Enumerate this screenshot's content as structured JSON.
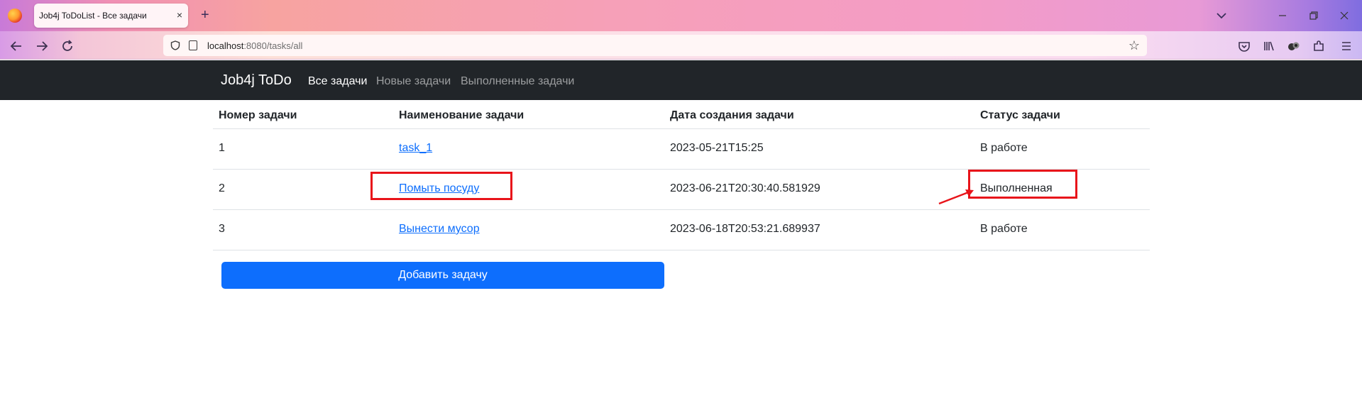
{
  "browser": {
    "tab_title": "Job4j ToDoList - Все задачи",
    "tab_close": "×",
    "new_tab": "+",
    "url_host": "localhost",
    "url_rest": ":8080/tasks/all",
    "icons": [
      "firefox-logo",
      "back-icon",
      "forward-icon",
      "reload-icon",
      "shield-icon",
      "page-icon",
      "star-icon",
      "pocket-icon",
      "library-icon",
      "extension-icon",
      "puzzle-icon",
      "menu-icon",
      "tab-list-icon"
    ]
  },
  "navbar": {
    "brand": "Job4j ToDo",
    "links": [
      {
        "label": "Все задачи",
        "active": true
      },
      {
        "label": "Новые задачи",
        "active": false
      },
      {
        "label": "Выполненные задачи",
        "active": false
      }
    ]
  },
  "table": {
    "headers": [
      "Номер задачи",
      "Наименование задачи",
      "Дата создания задачи",
      "Статус задачи"
    ],
    "rows": [
      {
        "id": "1",
        "name": "task_1",
        "created": "2023-05-21T15:25",
        "status": "В работе"
      },
      {
        "id": "2",
        "name": "Помыть посуду",
        "created": "2023-06-21T20:30:40.581929",
        "status": "Выполненная"
      },
      {
        "id": "3",
        "name": "Вынести мусор",
        "created": "2023-06-18T20:53:21.689937",
        "status": "В работе"
      }
    ]
  },
  "actions": {
    "add_label": "Добавить задачу"
  },
  "colors": {
    "navbar_bg": "#212529",
    "primary": "#0d6efd",
    "annotation": "#e8141a"
  }
}
